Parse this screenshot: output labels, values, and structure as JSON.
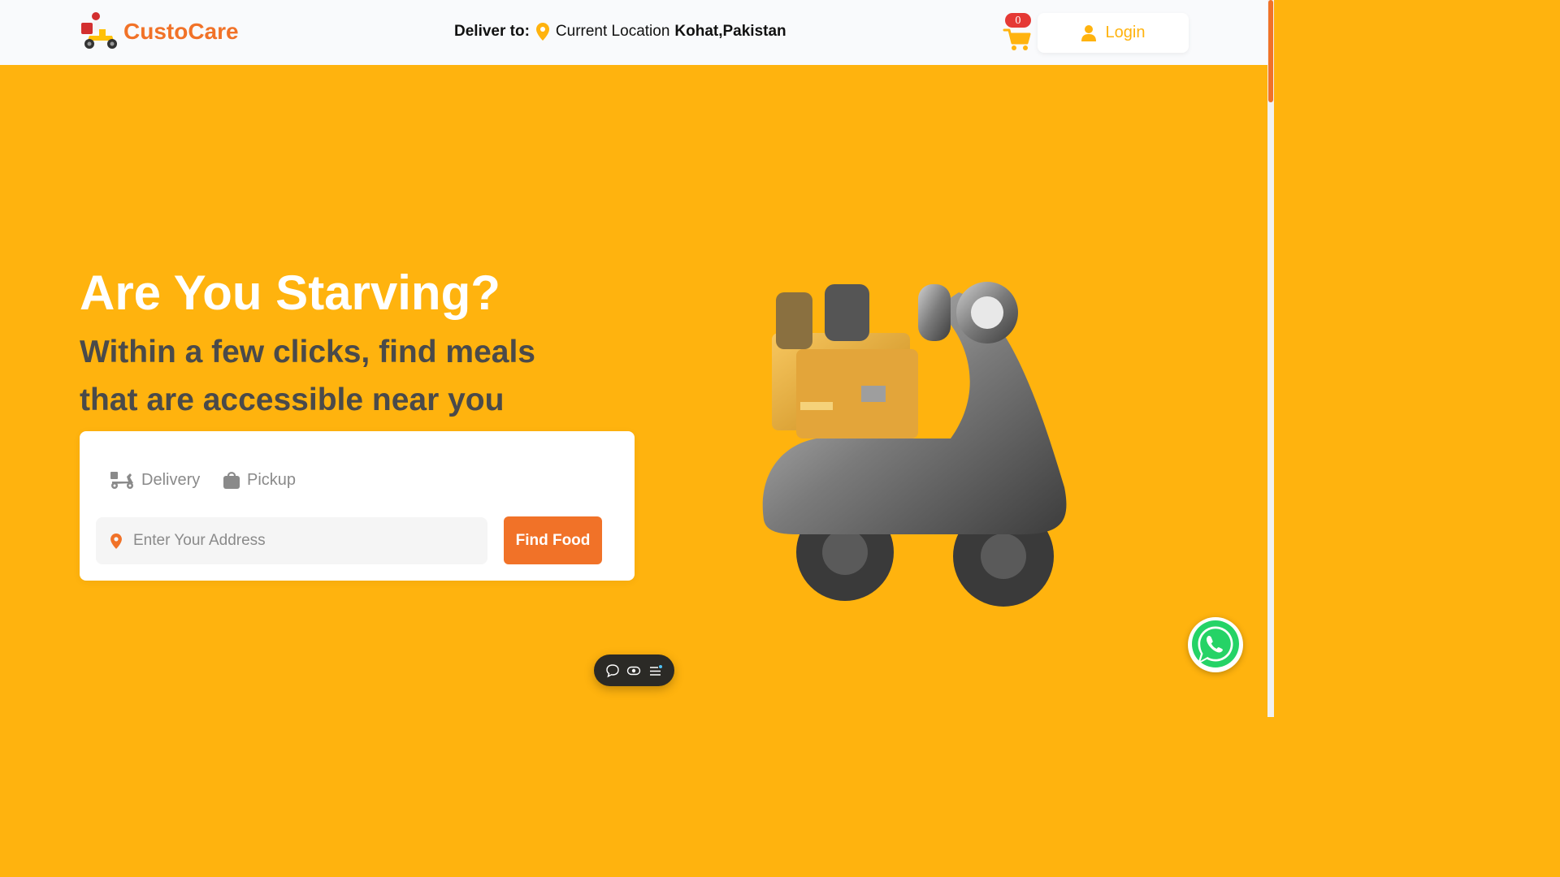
{
  "header": {
    "brand": "CustoCare",
    "deliver_label": "Deliver to:",
    "location_prefix": "Current Location",
    "location_city": "Kohat,Pakistan",
    "cart_count": "0",
    "login_label": "Login"
  },
  "hero": {
    "title": "Are You Starving?",
    "subtitle": "Within a few clicks, find meals that are accessible near you"
  },
  "search": {
    "tabs": [
      {
        "label": "Delivery",
        "icon": "scooter-icon"
      },
      {
        "label": "Pickup",
        "icon": "shopping-bag-icon"
      }
    ],
    "address_placeholder": "Enter Your Address",
    "button_label": "Find Food"
  },
  "colors": {
    "background": "#FFB30E",
    "accent": "#F17228",
    "header_bg": "#F9FAFC",
    "badge": "#E53935"
  },
  "icons": [
    "logo-rider-icon",
    "location-pin-icon",
    "cart-icon",
    "user-icon",
    "scooter-icon",
    "shopping-bag-icon",
    "chat-icon",
    "eye-icon",
    "menu-icon",
    "whatsapp-icon"
  ]
}
